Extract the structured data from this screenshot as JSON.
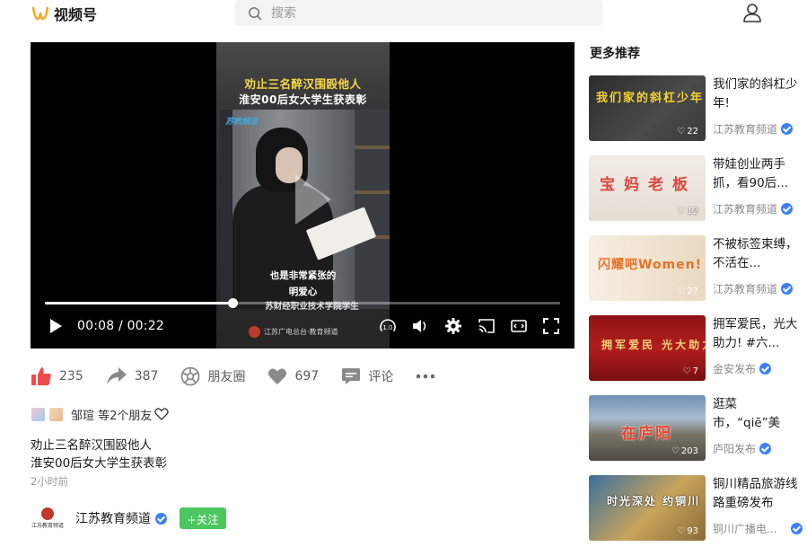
{
  "header": {
    "app_name": "视频号",
    "search_placeholder": "搜索"
  },
  "video": {
    "frame_title_line1": "劝止三名醉汉围殴他人",
    "frame_title_line2": "淮安00后女大学生获表彰",
    "frame_stamp": "苏教频道",
    "subtitle_line1": "也是非常紧张的",
    "subtitle_line2": "明爱心",
    "subtitle_line3": "苏财经职业技术学院学生",
    "frame_footer": "江苏广电总台·教育频道",
    "current_time": "00:08",
    "duration": "00:22",
    "time_separator": " / ",
    "progress_fraction": 0.3636,
    "speed_label": "1.0"
  },
  "actions": {
    "like_count": "235",
    "share_count": "387",
    "moments_label": "朋友圈",
    "heart_count": "697",
    "comment_label": "评论"
  },
  "friends": {
    "text": "邹瑄 等2个朋友"
  },
  "post": {
    "desc_line1": "劝止三名醉汉围殴他人",
    "desc_line2": "淮安00后女大学生获表彰",
    "posted_time": "2小时前"
  },
  "author": {
    "avatar_caption": "江苏教育频道",
    "name": "江苏教育频道",
    "follow_label": "+关注"
  },
  "recommendations": {
    "title": "更多推荐",
    "items": [
      {
        "title": "我们家的斜杠少年!",
        "author": "江苏教育频道",
        "likes": "22",
        "thumb_text": "我们家的斜杠少年",
        "verified": true
      },
      {
        "title": "带娃创业两手抓，看90后...",
        "author": "江苏教育频道",
        "likes": "12",
        "thumb_text": "宝妈老板",
        "verified": true
      },
      {
        "title": "不被标签束缚，不活在...",
        "author": "江苏教育频道",
        "likes": "27",
        "thumb_text": "闪耀吧Women!",
        "verified": true
      },
      {
        "title": "拥军爱民，光大助力! #六...",
        "author": "金安发布",
        "likes": "7",
        "thumb_text": "拥军爱民 光大助力",
        "verified": true
      },
      {
        "title": "逛菜市，“qiē”美食，打年...",
        "author": "庐阳发布",
        "likes": "203",
        "thumb_text": "在庐阳",
        "verified": true
      },
      {
        "title": "铜川精品旅游线路重磅发布",
        "author": "铜川广播电...",
        "likes": "93",
        "thumb_text": "时光深处 约铜川",
        "verified": true
      }
    ]
  },
  "colors": {
    "like_red": "#f04b4b",
    "follow_green": "#4cc65e",
    "verify_blue": "#3d7ff5",
    "logo_orange": "#f6a623"
  }
}
